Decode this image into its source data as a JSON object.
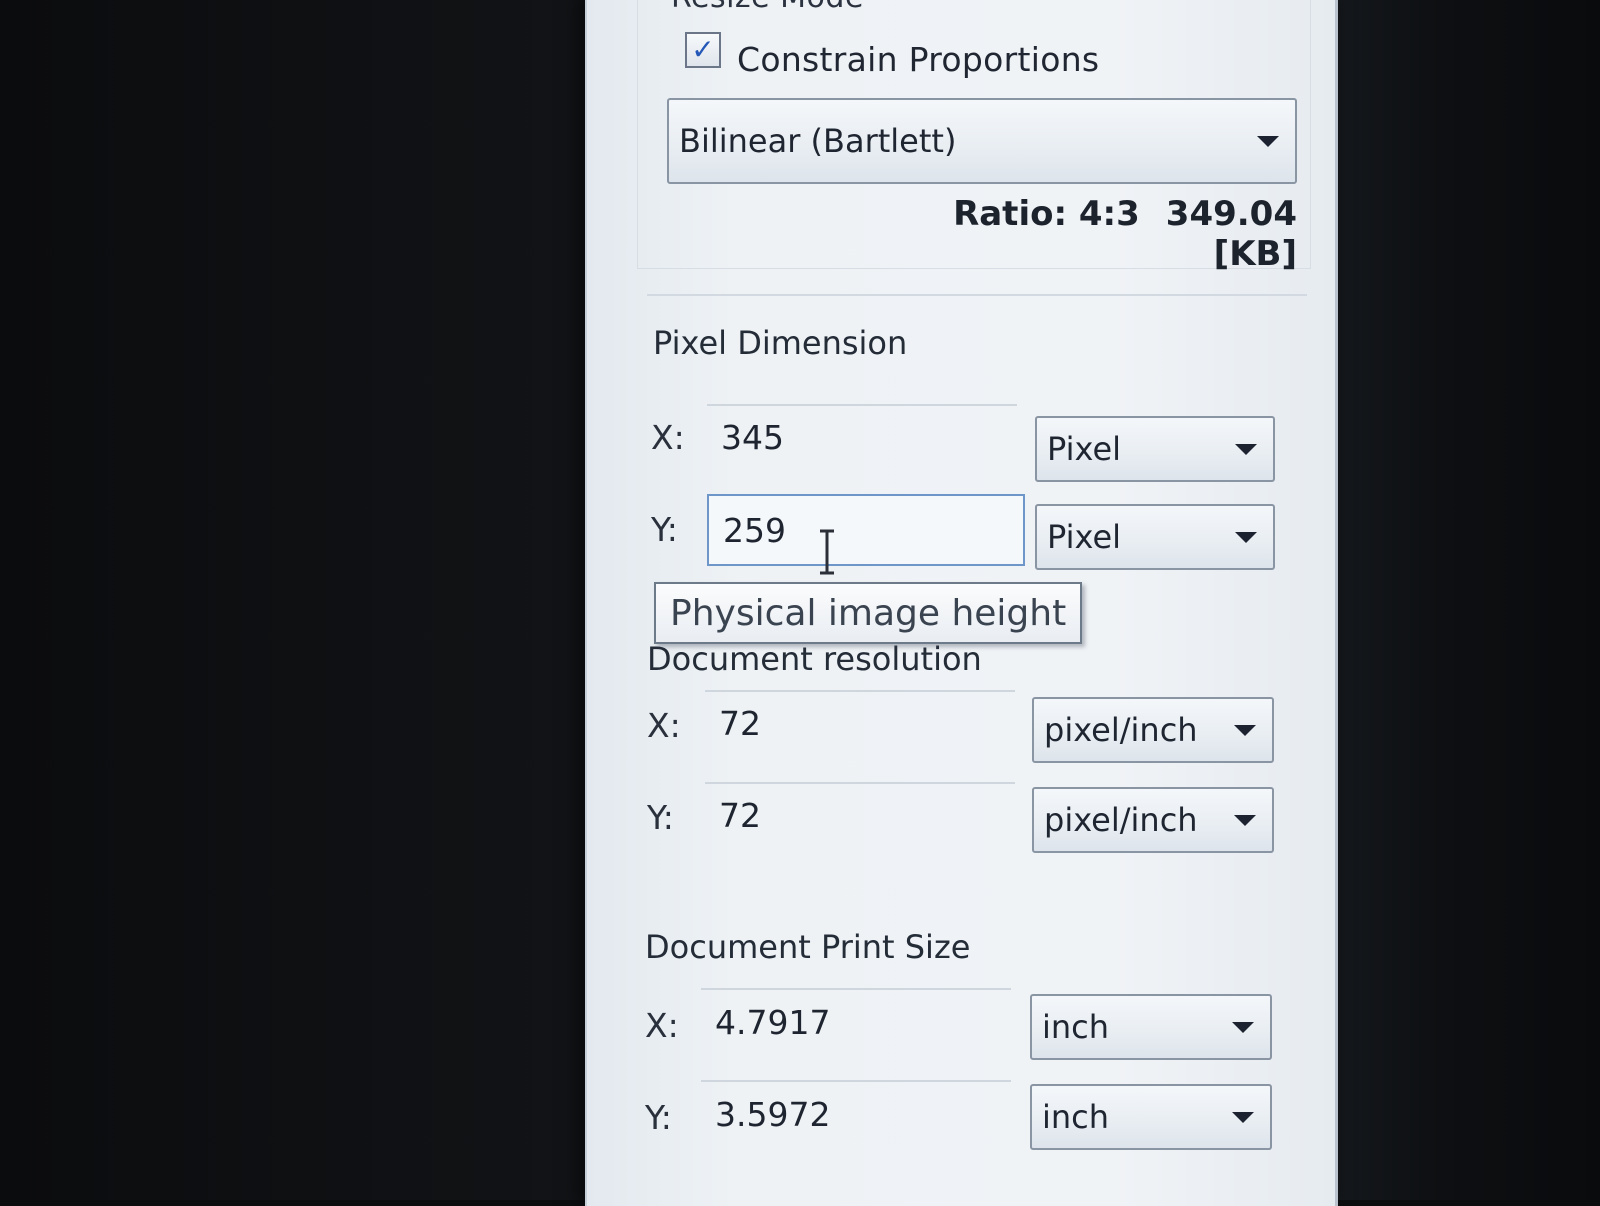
{
  "resize_mode": {
    "section_title": "Resize Mode",
    "constrain_checkbox": {
      "label": "Constrain Proportions",
      "checked": true
    },
    "interpolation": {
      "selected": "Bilinear (Bartlett)"
    },
    "ratio": "Ratio: 4:3",
    "file_size": "349.04 [KB]"
  },
  "pixel_dimension": {
    "title": "Pixel Dimension",
    "x": {
      "label": "X:",
      "value": "345",
      "unit": "Pixel"
    },
    "y": {
      "label": "Y:",
      "value": "259",
      "unit": "Pixel"
    }
  },
  "tooltip": {
    "text": "Physical image height"
  },
  "document_resolution": {
    "title": "Document resolution",
    "x": {
      "label": "X:",
      "value": "72",
      "unit": "pixel/inch"
    },
    "y": {
      "label": "Y:",
      "value": "72",
      "unit": "pixel/inch"
    }
  },
  "document_print_size": {
    "title": "Document Print Size",
    "x": {
      "label": "X:",
      "value": "4.7917",
      "unit": "inch"
    },
    "y": {
      "label": "Y:",
      "value": "3.5972",
      "unit": "inch"
    }
  },
  "colors": {
    "panel_bg": "#eef2f5",
    "check_mark": "#2458b8",
    "active_field_border": "#6f96c8",
    "desktop_bg": "#0c0d0f"
  },
  "icons": {
    "combo_arrow": "chevron-down-icon",
    "check": "check-icon",
    "text_cursor": "text-cursor-icon"
  }
}
